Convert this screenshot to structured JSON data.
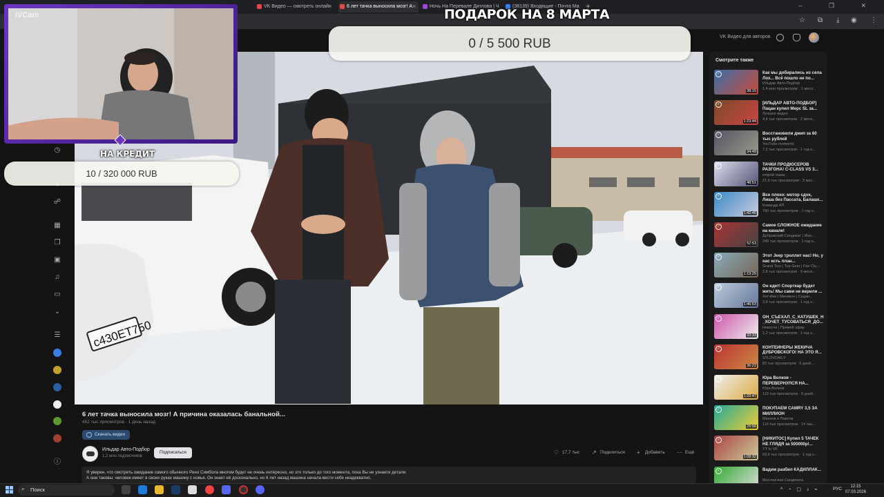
{
  "browser": {
    "tabs": [
      {
        "label": "VK Видео — смотреть онлайн",
        "color": "#e04a4a"
      },
      {
        "label": "6 лет тачка выносила мозг! А",
        "color": "#e04a4a"
      },
      {
        "label": "Ночь На Перевале Дятлова | Ч",
        "color": "#9b4bd0"
      },
      {
        "label": "(38139) Входящие - Почта Ма",
        "color": "#3b7de0"
      }
    ],
    "new_tab": "+",
    "window_controls": "– ❐ ✕"
  },
  "header": {
    "vk_for_authors": "VK Видео для авторов"
  },
  "overlay": {
    "cam_label": "IVCam",
    "goal1_title": "ПОДАРОК НА 8 МАРТА",
    "goal1_progress": "0 / 5 500 RUB",
    "goal1_fraction": 0,
    "goal2_title": "НА КРЕДИТ",
    "goal2_progress": "10 / 320 000 RUB",
    "goal2_fraction": 3e-05,
    "goal_fill_color": "#3bb8a8",
    "frame_color": "#6b36c0"
  },
  "video": {
    "title": "6 лет тачка выносила мозг! А причина оказалась банальной...",
    "stats": "452 тыс просмотров · 1 день назад",
    "download_label": "Скачать видео",
    "channel_name": "Ильдар Авто-Подбор",
    "channel_subs": "1,2 млн подписчиков",
    "subscribe_label": "Подписаться",
    "likes": "17,7 тыс",
    "share_label": "Поделиться",
    "add_label": "Добавить",
    "more_label": "Ещё",
    "license_plate": "с430ЕТ750",
    "description": "Я уверен, что смотреть ожидание самого обычного Рено Симбола многим будет не очень интересно, но это только до того момента, пока Вы не узнаете детали.",
    "description2": "А они таковы: человек имеет в своих руках машину с новья. Он знает её досконально, но 6 лет назад машина начала вести себя неадекватно."
  },
  "related": {
    "heading": "Смотрите также",
    "items": [
      {
        "title": "Как мы добирались из села Лох... Всё пошло не по...",
        "channel": "Ильдар Авто-Подбор",
        "views": "1,4 млн просмотров · 1 меся...",
        "duration": "38:15",
        "c1": "#3a6fa8",
        "c2": "#c94a3a"
      },
      {
        "title": "[ИЛЬДАР АВТО-ПОДБОР] Пацан купил Мерс SL за...",
        "channel": "Лучшее видео",
        "views": "4,4 тыс просмотров · 2 меся...",
        "duration": "1:23:44",
        "c1": "#7a4a2a",
        "c2": "#c44"
      },
      {
        "title": "Восстановили джип за 60 тыс рублей",
        "channel": "YouTube moments",
        "views": "7,2 тыс просмотров · 1 год н...",
        "duration": "34:49",
        "c1": "#556",
        "c2": "#998"
      },
      {
        "title": "ТАЧКИ ПРОДЮСЕРОВ РАЗГОНА! C-CLASS VS 3...",
        "channel": "открой гоаха.",
        "views": "21,9 тыс просмотров · 3 мес...",
        "duration": "48:51",
        "c1": "#dde",
        "c2": "#557"
      },
      {
        "title": "Все плохо: мотор сдох, Лиша без Пассата, Балашк...",
        "channel": "Команда АП",
        "views": "780 тыс просмотров · 1 год н...",
        "duration": "1:42:40",
        "c1": "#3a8ac8",
        "c2": "#ccd"
      },
      {
        "title": "Самое СЛОЖНОЕ ожидание на канале!",
        "channel": "Дубровский Синдикат | Жек...",
        "views": "249 тыс просмотров · 1 год н...",
        "duration": "52:53",
        "c1": "#a33",
        "c2": "#444"
      },
      {
        "title": "Этот Jeep троллит нас! Но, у нас есть план...",
        "channel": "Grand Tour | Top Gear | Fan Clu...",
        "views": "2,8 тыс просмотров · 9 меся...",
        "duration": "1:19:29",
        "c1": "#8ab",
        "c2": "#765"
      },
      {
        "title": "Он едет! Спорткар будет жить! Мы сами не верили ...",
        "channel": "Хетчбек | Минивэн | Седан...",
        "views": "3,8 тыс просмотров · 1 год н...",
        "duration": "1:46:53",
        "c1": "#bcd",
        "c2": "#679"
      },
      {
        "title": "ОН_СЪЕХАЛ_С_КАТУШЕК_Н _ХОЧЕТ_ТУСОВАТЬСЯ_ДО...",
        "channel": "Новости | Прямой эфир",
        "views": "2,2 тыс просмотров · 1 год н...",
        "duration": "33:33",
        "c1": "#c5a",
        "c2": "#eee"
      },
      {
        "title": "КОНТЕЙНЕРЫ ЖЕКИЧА ДУБРОВСКОГО! НА ЭТО Я...",
        "channel": "STLOVDAILY",
        "views": "82 тыс просмотров · 6 дней...",
        "duration": "36:22",
        "c1": "#b33",
        "c2": "#c84"
      },
      {
        "title": "Юра Волков - ПЕРЕВЕРНУЛСЯ НА...",
        "channel": "Юра Волков",
        "views": "118 тыс просмотров · 6 дней...",
        "duration": "1:23:47",
        "c1": "#eee",
        "c2": "#da4"
      },
      {
        "title": "ПОКУПАЕМ CAMRY 3,5 ЗА МИЛЛИОН",
        "channel": "Михеев и Павлов",
        "views": "116 тыс просмотров · 14 час...",
        "duration": "29:56",
        "c1": "#2a9",
        "c2": "#ec3"
      },
      {
        "title": "[НИКИТОС] Купил 5 ТАЧЕК НЕ ГЛЯДЯ за 500000р!...",
        "channel": "YT to VK",
        "views": "63,9 тыс просмотров · 1 год н...",
        "duration": "1:08:32",
        "c1": "#a44",
        "c2": "#cc9"
      },
      {
        "title": "Вадим разбил КАДИЛЛАК...",
        "channel": "Мастерская Синдиката",
        "views": "",
        "duration": "",
        "c1": "#3a3",
        "c2": "#ddd"
      }
    ]
  },
  "taskbar": {
    "search_placeholder": "Поиск",
    "lang": "РУС",
    "time": "12:15",
    "date": "07.03.2026"
  }
}
